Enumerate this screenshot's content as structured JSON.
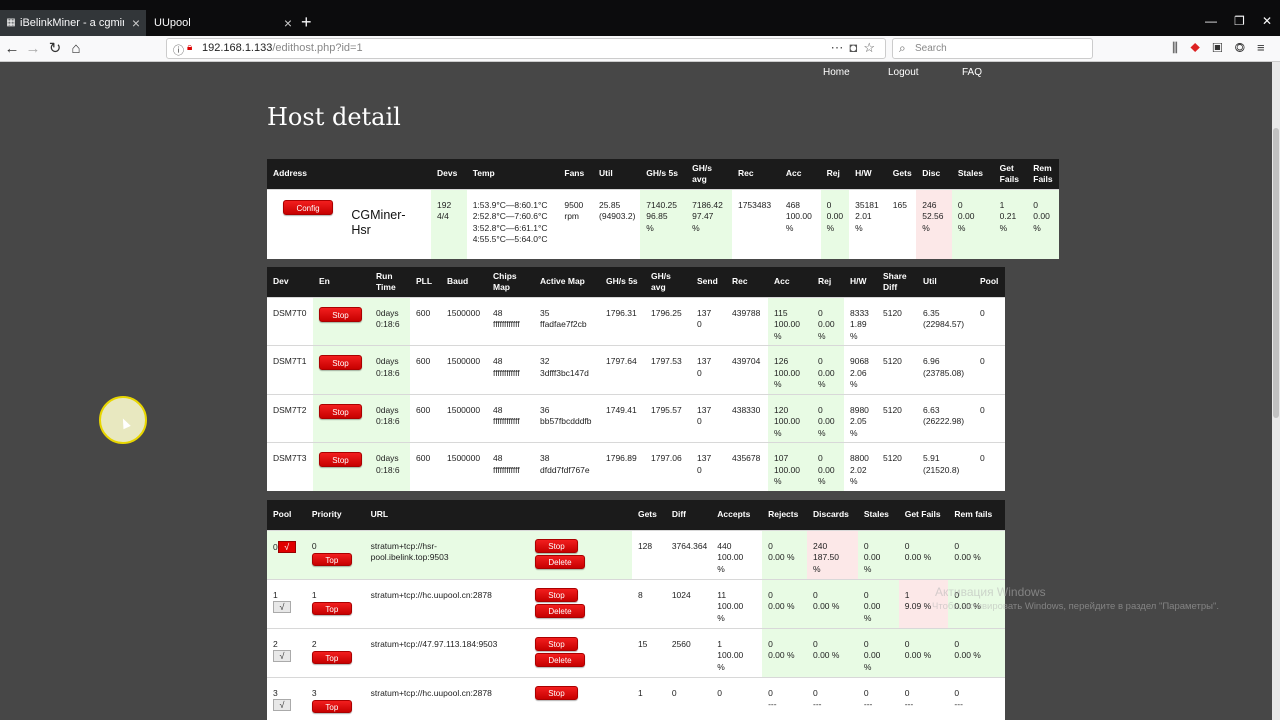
{
  "browser": {
    "tabs": [
      {
        "title": "iBelinkMiner - a cgminer web m",
        "active": true
      },
      {
        "title": "UUpool",
        "active": false
      }
    ],
    "url_host": "192.168.1.133",
    "url_path": "/edithost.php?id=1",
    "search_placeholder": "Search"
  },
  "nav": {
    "home": "Home",
    "logout": "Logout",
    "faq": "FAQ"
  },
  "page_title": "Host detail",
  "summary": {
    "headers": [
      "Address",
      "Devs",
      "Temp",
      "Fans",
      "Util",
      "GH/s 5s",
      "GH/s avg",
      "Rec",
      "Acc",
      "Rej",
      "H/W",
      "Gets",
      "Disc",
      "Stales",
      "Get Fails",
      "Rem Fails"
    ],
    "config_label": "Config",
    "hostname": "CGMiner-Hsr",
    "devs": "192\n4/4",
    "temp": "1:53.9°C—8:60.1°C\n2:52.8°C—7:60.6°C\n3:52.8°C—6:61.1°C\n4:55.5°C—5:64.0°C",
    "fans": "9500\nrpm",
    "util": "25.85\n(94903.2)",
    "ghs5s": "7140.25\n96.85\n%",
    "ghsavg": "7186.42\n97.47\n%",
    "rec": "1753483",
    "acc": "468\n100.00\n%",
    "rej": "0\n0.00\n%",
    "hw": "35181\n2.01\n%",
    "gets": "165",
    "disc": "246\n52.56\n%",
    "stales": "0\n0.00\n%",
    "getfails": "1\n0.21\n%",
    "remfails": "0\n0.00\n%"
  },
  "devices": {
    "headers": [
      "Dev",
      "En",
      "Run Time",
      "PLL",
      "Baud",
      "Chips Map",
      "Active Map",
      "GH/s 5s",
      "GH/s avg",
      "Send",
      "Rec",
      "Acc",
      "Rej",
      "H/W",
      "Share Diff",
      "Util",
      "Pool"
    ],
    "stop_label": "Stop",
    "rows": [
      {
        "dev": "DSM7T0",
        "runtime": "0days\n0:18:6",
        "pll": "600",
        "baud": "1500000",
        "chips": "48\nffffffffffff",
        "active": "35\nffadfae7f2cb",
        "ghs5s": "1796.31",
        "ghsavg": "1796.25",
        "send": "137\n0",
        "rec": "439788",
        "acc": "115\n100.00\n%",
        "rej": "0\n0.00\n%",
        "hw": "8333\n1.89\n%",
        "diff": "5120",
        "util": "6.35\n(22984.57)",
        "pool": "0"
      },
      {
        "dev": "DSM7T1",
        "runtime": "0days\n0:18:6",
        "pll": "600",
        "baud": "1500000",
        "chips": "48\nffffffffffff",
        "active": "32\n3dfff3bc147d",
        "ghs5s": "1797.64",
        "ghsavg": "1797.53",
        "send": "137\n0",
        "rec": "439704",
        "acc": "126\n100.00\n%",
        "rej": "0\n0.00\n%",
        "hw": "9068\n2.06\n%",
        "diff": "5120",
        "util": "6.96\n(23785.08)",
        "pool": "0"
      },
      {
        "dev": "DSM7T2",
        "runtime": "0days\n0:18:6",
        "pll": "600",
        "baud": "1500000",
        "chips": "48\nffffffffffff",
        "active": "36\nbb57fbcdddfb",
        "ghs5s": "1749.41",
        "ghsavg": "1795.57",
        "send": "137\n0",
        "rec": "438330",
        "acc": "120\n100.00\n%",
        "rej": "0\n0.00\n%",
        "hw": "8980\n2.05\n%",
        "diff": "5120",
        "util": "6.63\n(26222.98)",
        "pool": "0"
      },
      {
        "dev": "DSM7T3",
        "runtime": "0days\n0:18:6",
        "pll": "600",
        "baud": "1500000",
        "chips": "48\nffffffffffff",
        "active": "38\ndfdd7fdf767e",
        "ghs5s": "1796.89",
        "ghsavg": "1797.06",
        "send": "137\n0",
        "rec": "435678",
        "acc": "107\n100.00\n%",
        "rej": "0\n0.00\n%",
        "hw": "8800\n2.02\n%",
        "diff": "5120",
        "util": "5.91\n(21520.8)",
        "pool": "0"
      }
    ]
  },
  "pools": {
    "headers": [
      "Pool",
      "Priority",
      "URL",
      "",
      "Gets",
      "Diff",
      "Accepts",
      "Rejects",
      "Discards",
      "Stales",
      "Get Fails",
      "Rem fails"
    ],
    "stop_label": "Stop",
    "delete_label": "Delete",
    "top_label": "Top",
    "check_mark": "√",
    "rows": [
      {
        "pool": "0",
        "priority": "0",
        "url": "stratum+tcp://hsr-\npool.ibelink.top:9503",
        "gets": "128",
        "diff": "3764.364",
        "accepts": "440\n100.00\n%",
        "rejects": "0\n0.00 %",
        "discards": "240\n187.50\n%",
        "stales": "0\n0.00\n%",
        "getfails": "0\n0.00 %",
        "remfails": "0\n0.00 %"
      },
      {
        "pool": "1",
        "priority": "1",
        "url": "stratum+tcp://hc.uupool.cn:2878",
        "gets": "8",
        "diff": "1024",
        "accepts": "11\n100.00\n%",
        "rejects": "0\n0.00 %",
        "discards": "0\n0.00 %",
        "stales": "0\n0.00\n%",
        "getfails": "1\n9.09 %",
        "remfails": "0\n0.00 %"
      },
      {
        "pool": "2",
        "priority": "2",
        "url": "stratum+tcp://47.97.113.184:9503",
        "gets": "15",
        "diff": "2560",
        "accepts": "1\n100.00\n%",
        "rejects": "0\n0.00 %",
        "discards": "0\n0.00 %",
        "stales": "0\n0.00\n%",
        "getfails": "0\n0.00 %",
        "remfails": "0\n0.00 %"
      },
      {
        "pool": "3",
        "priority": "3",
        "url": "stratum+tcp://hc.uupool.cn:2878",
        "gets": "1",
        "diff": "0",
        "accepts": "0",
        "rejects": "0\n---",
        "discards": "0\n---",
        "stales": "0\n---",
        "getfails": "0\n---",
        "remfails": "0\n---"
      }
    ]
  },
  "watermark": {
    "line1": "Активация Windows",
    "line2": "Чтобы активировать Windows, перейдите в раздел \"Параметры\"."
  },
  "colors": {
    "accent_red": "#e00000",
    "ok_green": "#e8fbe4",
    "warn_pink": "#fce8e8",
    "header_black": "#1b1b1b",
    "page_bg": "#474747"
  }
}
